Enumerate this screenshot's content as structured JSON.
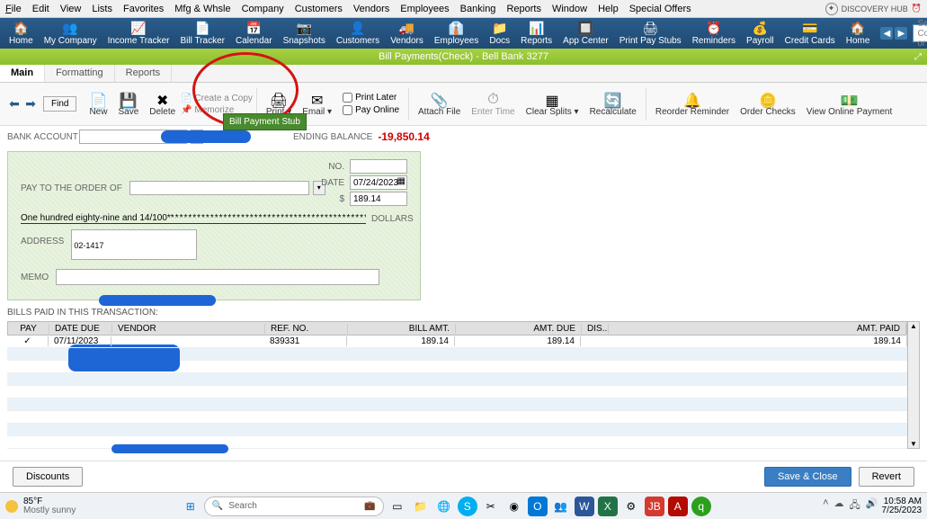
{
  "menu": {
    "file": "File",
    "edit": "Edit",
    "view": "View",
    "lists": "Lists",
    "favorites": "Favorites",
    "mfg": "Mfg & Whsle",
    "company": "Company",
    "customers": "Customers",
    "vendors": "Vendors",
    "employees": "Employees",
    "banking": "Banking",
    "reports": "Reports",
    "window": "Window",
    "help": "Help",
    "special": "Special Offers",
    "discovery": "DISCOVERY HUB"
  },
  "nav": {
    "home": "Home",
    "mycompany": "My Company",
    "income": "Income Tracker",
    "bill": "Bill Tracker",
    "calendar": "Calendar",
    "snapshots": "Snapshots",
    "customers": "Customers",
    "vendors": "Vendors",
    "employees": "Employees",
    "docs": "Docs",
    "reports": "Reports",
    "appcenter": "App Center",
    "paystubs": "Print Pay Stubs",
    "reminders": "Reminders",
    "payroll": "Payroll",
    "cc": "Credit Cards",
    "home2": "Home",
    "search_ph": "Search Company or Help"
  },
  "title": "Bill Payments(Check) - Bell Bank 3277",
  "tabs": {
    "main": "Main",
    "formatting": "Formatting",
    "reports": "Reports"
  },
  "toolbar": {
    "find": "Find",
    "new": "New",
    "save": "Save",
    "delete": "Delete",
    "create_copy": "Create a Copy",
    "memorize": "Memorize",
    "print": "Print",
    "email": "Email",
    "print_later": "Print Later",
    "pay_online": "Pay Online",
    "attach": "Attach File",
    "enter_time": "Enter Time",
    "clear_splits": "Clear Splits",
    "recalc": "Recalculate",
    "reorder": "Reorder Reminder",
    "order_checks": "Order Checks",
    "view_online": "View Online Payment"
  },
  "tooltip": "Bill Payment Stub",
  "bankrow": {
    "label": "BANK ACCOUNT",
    "ending": "ENDING BALANCE",
    "balance": "-19,850.14"
  },
  "check": {
    "no": "NO.",
    "date_lbl": "DATE",
    "date": "07/24/2023",
    "amt_sym": "$",
    "amount": "189.14",
    "payto": "PAY TO THE ORDER OF",
    "written": "One hundred eighty-nine and 14/100*",
    "stars": "***********************************************************************",
    "dollars": "DOLLARS",
    "address": "ADDRESS",
    "addr_val": "02-1417",
    "memo": "MEMO"
  },
  "grid": {
    "title": "BILLS PAID IN THIS TRANSACTION:",
    "pay": "PAY",
    "datedue": "DATE DUE",
    "vendor": "VENDOR",
    "refno": "REF. NO.",
    "billamt": "BILL AMT.",
    "amtdue": "AMT. DUE",
    "dis": "DIS...",
    "amtpaid": "AMT. PAID",
    "rows": [
      {
        "pay": "✓",
        "date": "07/11/2023",
        "vendor": "",
        "ref": "839331",
        "billamt": "189.14",
        "amtdue": "189.14",
        "dis": "",
        "amtpaid": "189.14"
      }
    ]
  },
  "footer": {
    "discounts": "Discounts",
    "save": "Save & Close",
    "revert": "Revert"
  },
  "taskbar": {
    "temp": "85°F",
    "cond": "Mostly sunny",
    "search": "Search",
    "time": "10:58 AM",
    "date": "7/25/2023"
  }
}
